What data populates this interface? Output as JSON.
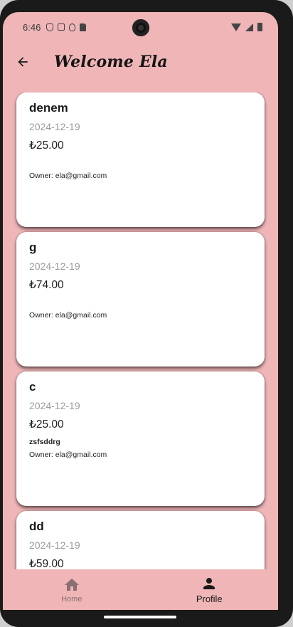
{
  "status_bar": {
    "time": "6:46"
  },
  "app_bar": {
    "title": "Welcome Ela"
  },
  "cards": [
    {
      "title": "denem",
      "date": "2024-12-19",
      "price": "₺25.00",
      "description": "",
      "owner": "Owner: ela@gmail.com"
    },
    {
      "title": "g",
      "date": "2024-12-19",
      "price": "₺74.00",
      "description": "",
      "owner": "Owner: ela@gmail.com"
    },
    {
      "title": "c",
      "date": "2024-12-19",
      "price": "₺25.00",
      "description": "zsfsddrg",
      "owner": "Owner: ela@gmail.com"
    },
    {
      "title": "dd",
      "date": "2024-12-19",
      "price": "₺59.00",
      "description": "",
      "owner": ""
    }
  ],
  "bottom_nav": {
    "items": [
      {
        "label": "Home",
        "icon": "home-icon",
        "active": false
      },
      {
        "label": "Profile",
        "icon": "person-icon",
        "active": true
      }
    ]
  },
  "colors": {
    "background": "#efb5b7",
    "card": "#ffffff",
    "date_text": "#9a9a9a"
  }
}
